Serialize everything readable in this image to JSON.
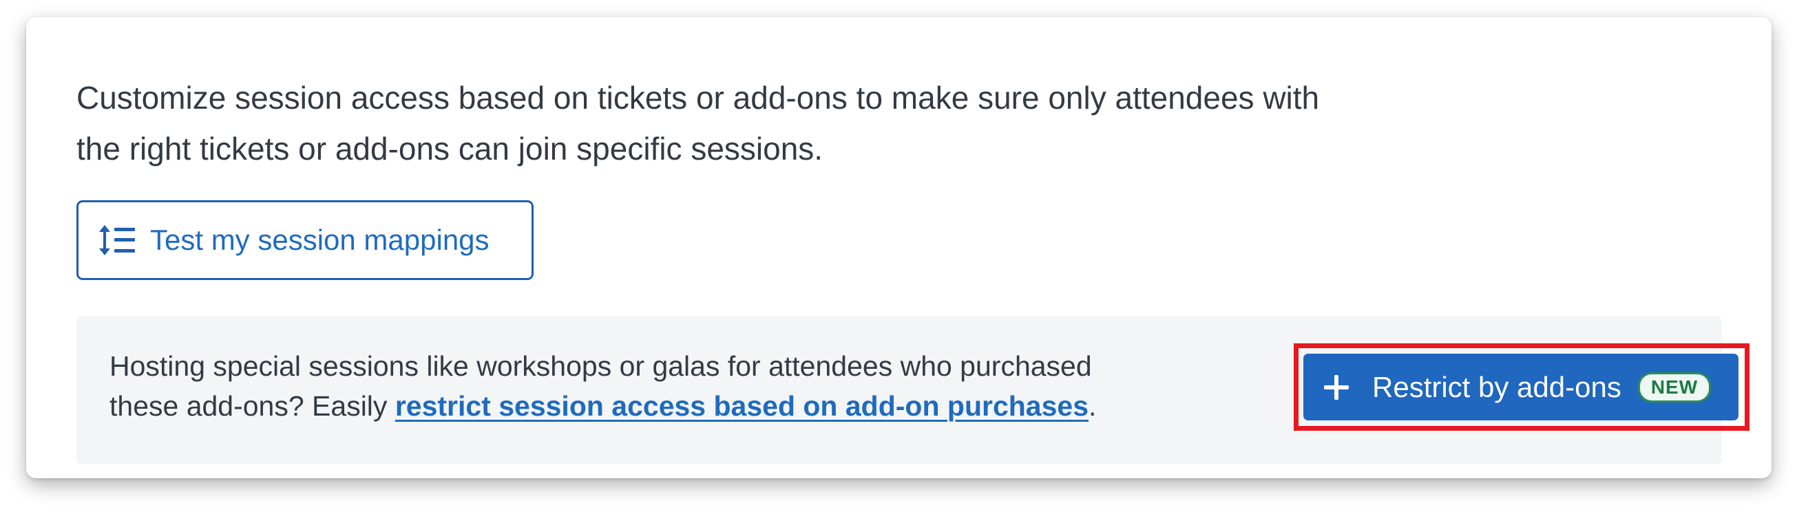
{
  "intro": {
    "line1": "Customize session access based on tickets or add-ons to make sure only attendees with",
    "line2": "the right tickets or add-ons can join specific sessions."
  },
  "test_button": {
    "label": "Test my session mappings",
    "icon": "sort-list-icon"
  },
  "promo": {
    "text_line1": "Hosting special sessions like workshops or galas for attendees who purchased",
    "text_prefix": "these add-ons? Easily ",
    "link_text": "restrict session access based on add-on purchases",
    "text_suffix": "."
  },
  "restrict_button": {
    "label": "Restrict by add-ons",
    "badge": "NEW",
    "icon": "plus-icon"
  },
  "colors": {
    "primary": "#1f67bf",
    "link": "#1f6bbd",
    "highlight": "#e5191f",
    "badge_green": "#2e8b57",
    "promo_bg": "#f3f5f7"
  }
}
